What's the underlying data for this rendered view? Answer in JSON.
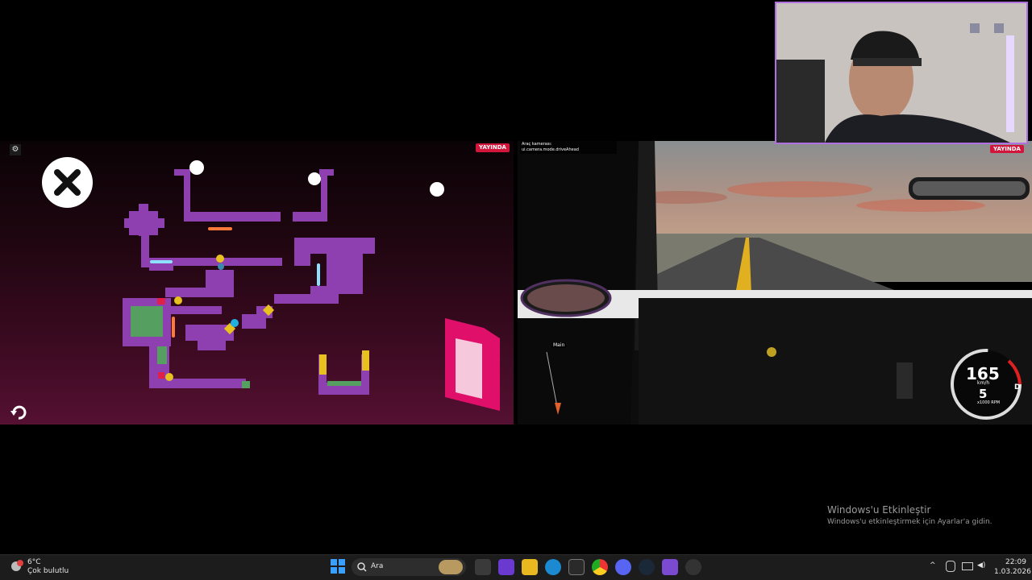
{
  "game": {
    "live_badge": "YAYINDA",
    "settings_icon": "⚙",
    "close_icon": "x-icon",
    "undo_icon": "undo-icon"
  },
  "drive": {
    "camera_label_line1": "Araç kamerası:",
    "camera_label_line2": "ui.camera.mode.driveAhead",
    "live_badge": "YAYINDA",
    "nav_label": "Main",
    "speed": "165",
    "speed_unit": "km/h",
    "gear": "5",
    "rpm_label": "x1000 RPM",
    "mode": "D"
  },
  "activation": {
    "title": "Windows'u Etkinleştir",
    "subtitle": "Windows'u etkinleştirmek için Ayarlar'a gidin."
  },
  "taskbar": {
    "weather_temp": "6°C",
    "weather_desc": "Çok bulutlu",
    "search_placeholder": "Ara",
    "time": "22:09",
    "date": "1.03.2026"
  }
}
